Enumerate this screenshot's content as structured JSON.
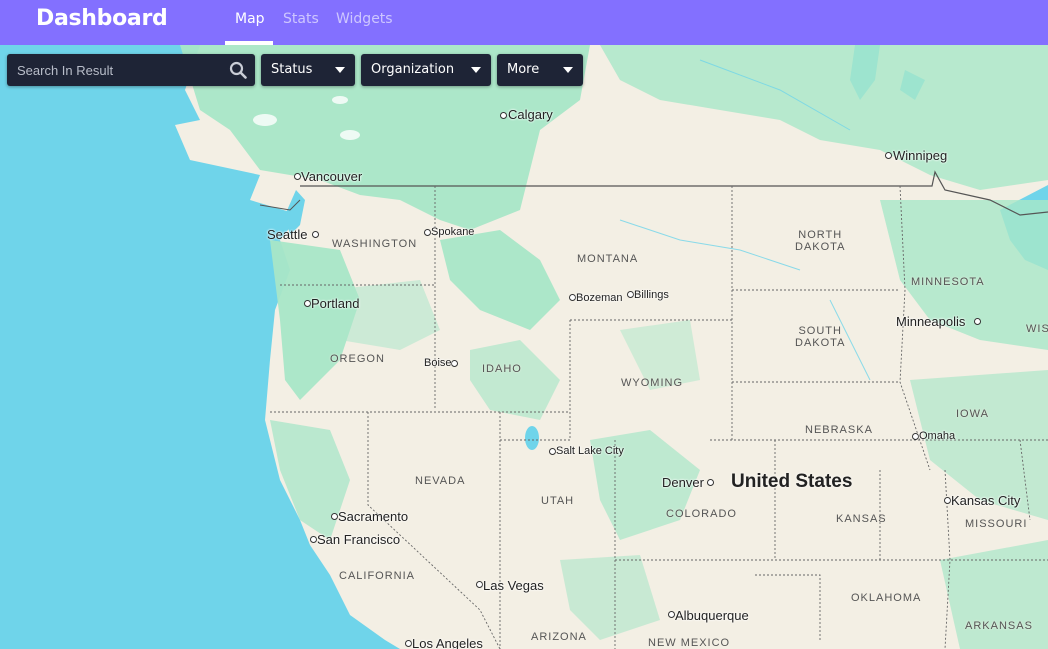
{
  "header": {
    "title": "Dashboard",
    "tabs": [
      {
        "label": "Map",
        "active": true
      },
      {
        "label": "Stats",
        "active": false
      },
      {
        "label": "Widgets",
        "active": false
      }
    ]
  },
  "toolbar": {
    "search_placeholder": "Search In Result",
    "search_icon": "search-icon",
    "filters": [
      {
        "label": "Status",
        "icon": "caret-down-icon"
      },
      {
        "label": "Organization",
        "icon": "caret-down-icon"
      },
      {
        "label": "More",
        "icon": "caret-down-icon"
      }
    ]
  },
  "map": {
    "country_label": "United States",
    "cities": [
      {
        "name": "Calgary"
      },
      {
        "name": "Winnipeg"
      },
      {
        "name": "Vancouver"
      },
      {
        "name": "Seattle"
      },
      {
        "name": "Spokane"
      },
      {
        "name": "Portland"
      },
      {
        "name": "Bozeman"
      },
      {
        "name": "Billings"
      },
      {
        "name": "Boise"
      },
      {
        "name": "Minneapolis"
      },
      {
        "name": "Salt Lake City"
      },
      {
        "name": "Omaha"
      },
      {
        "name": "Denver"
      },
      {
        "name": "Sacramento"
      },
      {
        "name": "San Francisco"
      },
      {
        "name": "Kansas City"
      },
      {
        "name": "Las Vegas"
      },
      {
        "name": "Albuquerque"
      },
      {
        "name": "Los Angeles"
      }
    ],
    "states": [
      {
        "name": "WASHINGTON"
      },
      {
        "name": "MONTANA"
      },
      {
        "name": "NORTH\nDAKOTA"
      },
      {
        "name": "MINNESOTA"
      },
      {
        "name": "SOUTH\nDAKOTA"
      },
      {
        "name": "OREGON"
      },
      {
        "name": "IDAHO"
      },
      {
        "name": "WYOMING"
      },
      {
        "name": "IOWA"
      },
      {
        "name": "NEBRASKA"
      },
      {
        "name": "NEVADA"
      },
      {
        "name": "UTAH"
      },
      {
        "name": "COLORADO"
      },
      {
        "name": "KANSAS"
      },
      {
        "name": "MISSOURI"
      },
      {
        "name": "CALIFORNIA"
      },
      {
        "name": "OKLAHOMA"
      },
      {
        "name": "ARIZONA"
      },
      {
        "name": "NEW MEXICO"
      },
      {
        "name": "ARKANSAS"
      },
      {
        "name": "WIS"
      }
    ],
    "colors": {
      "water": "#6fd4ea",
      "land": "#f3efe4",
      "forest": "#a8e6c8",
      "header": "#8370ff",
      "control_bg": "#1e2436"
    }
  }
}
